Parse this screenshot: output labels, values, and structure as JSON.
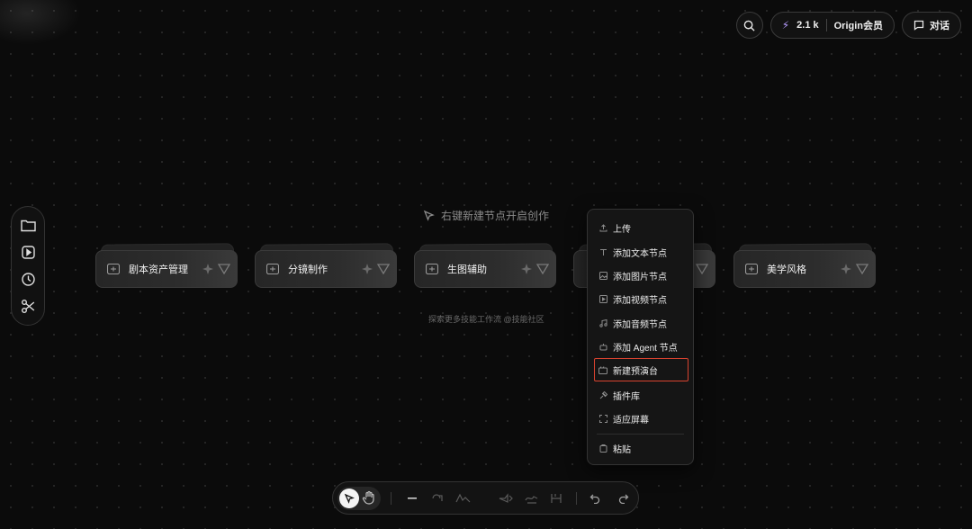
{
  "top_right": {
    "credits": "2.1 k",
    "membership": "Origin会员",
    "chat_label": "对话"
  },
  "canvas": {
    "hint": "右键新建节点开启创作",
    "explore_text": "探索更多技能工作流 @技能社区"
  },
  "cards": [
    {
      "label": "剧本资产管理"
    },
    {
      "label": "分镜制作"
    },
    {
      "label": "生图辅助"
    },
    {
      "label": ""
    },
    {
      "label": "美学风格"
    }
  ],
  "context_menu": {
    "items": [
      {
        "label": "上传",
        "icon": "upload-icon"
      },
      {
        "label": "添加文本节点",
        "icon": "text-icon"
      },
      {
        "label": "添加图片节点",
        "icon": "image-icon"
      },
      {
        "label": "添加视频节点",
        "icon": "video-icon"
      },
      {
        "label": "添加音频节点",
        "icon": "audio-icon"
      },
      {
        "label": "添加 Agent 节点",
        "icon": "agent-icon"
      },
      {
        "label": "新建预演台",
        "icon": "stage-icon",
        "highlighted": true
      },
      {
        "label": "插件库",
        "icon": "plugin-icon"
      },
      {
        "label": "适应屏幕",
        "icon": "fit-screen-icon"
      },
      {
        "label": "粘贴",
        "icon": "paste-icon"
      }
    ]
  },
  "left_toolbar": [
    "folder-icon",
    "media-icon",
    "history-icon",
    "scissors-icon"
  ],
  "bottom_toolbar": [
    "select-cursor-icon",
    "hand-icon",
    "minus-icon",
    "tool-icon",
    "tool-icon",
    "tool-icon",
    "tool-icon",
    "tool-icon",
    "undo-icon",
    "redo-icon"
  ],
  "colors": {
    "background": "#0b0b0b",
    "highlight": "#d9432f",
    "bolt": "#b79cff"
  }
}
